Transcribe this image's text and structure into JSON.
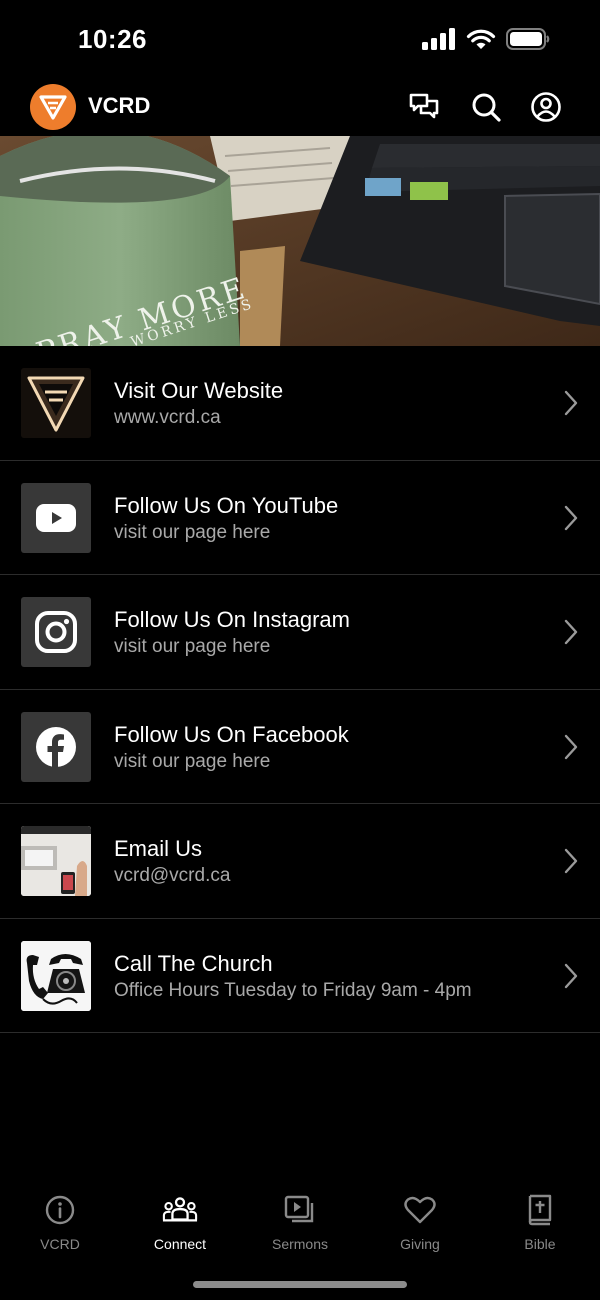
{
  "status_bar": {
    "time": "10:26"
  },
  "header": {
    "title": "VCRD",
    "icons": [
      "chat-bubbles-icon",
      "search-icon",
      "account-icon"
    ]
  },
  "hero": {
    "mug_text": "PRAY MORE",
    "mug_subtext": "WORRY LESS"
  },
  "links": [
    {
      "title": "Visit Our Website",
      "subtitle": "www.vcrd.ca",
      "icon": "vcrd-logo"
    },
    {
      "title": "Follow Us On YouTube",
      "subtitle": "visit our page here",
      "icon": "youtube-icon"
    },
    {
      "title": "Follow Us On Instagram",
      "subtitle": "visit our page here",
      "icon": "instagram-icon"
    },
    {
      "title": "Follow Us On Facebook",
      "subtitle": "visit our page here",
      "icon": "facebook-icon"
    },
    {
      "title": "Email Us",
      "subtitle": "vcrd@vcrd.ca",
      "icon": "email-photo"
    },
    {
      "title": "Call The Church",
      "subtitle": "Office Hours Tuesday to Friday 9am - 4pm",
      "icon": "phone-photo"
    }
  ],
  "tabs": [
    {
      "label": "VCRD",
      "icon": "info-icon",
      "active": false
    },
    {
      "label": "Connect",
      "icon": "people-icon",
      "active": true
    },
    {
      "label": "Sermons",
      "icon": "video-library-icon",
      "active": false
    },
    {
      "label": "Giving",
      "icon": "heart-icon",
      "active": false
    },
    {
      "label": "Bible",
      "icon": "bible-icon",
      "active": false
    }
  ],
  "colors": {
    "brand": "#ee7d2c",
    "background": "#000000",
    "divider": "#2c2c2c",
    "muted": "#a9a9a9"
  }
}
